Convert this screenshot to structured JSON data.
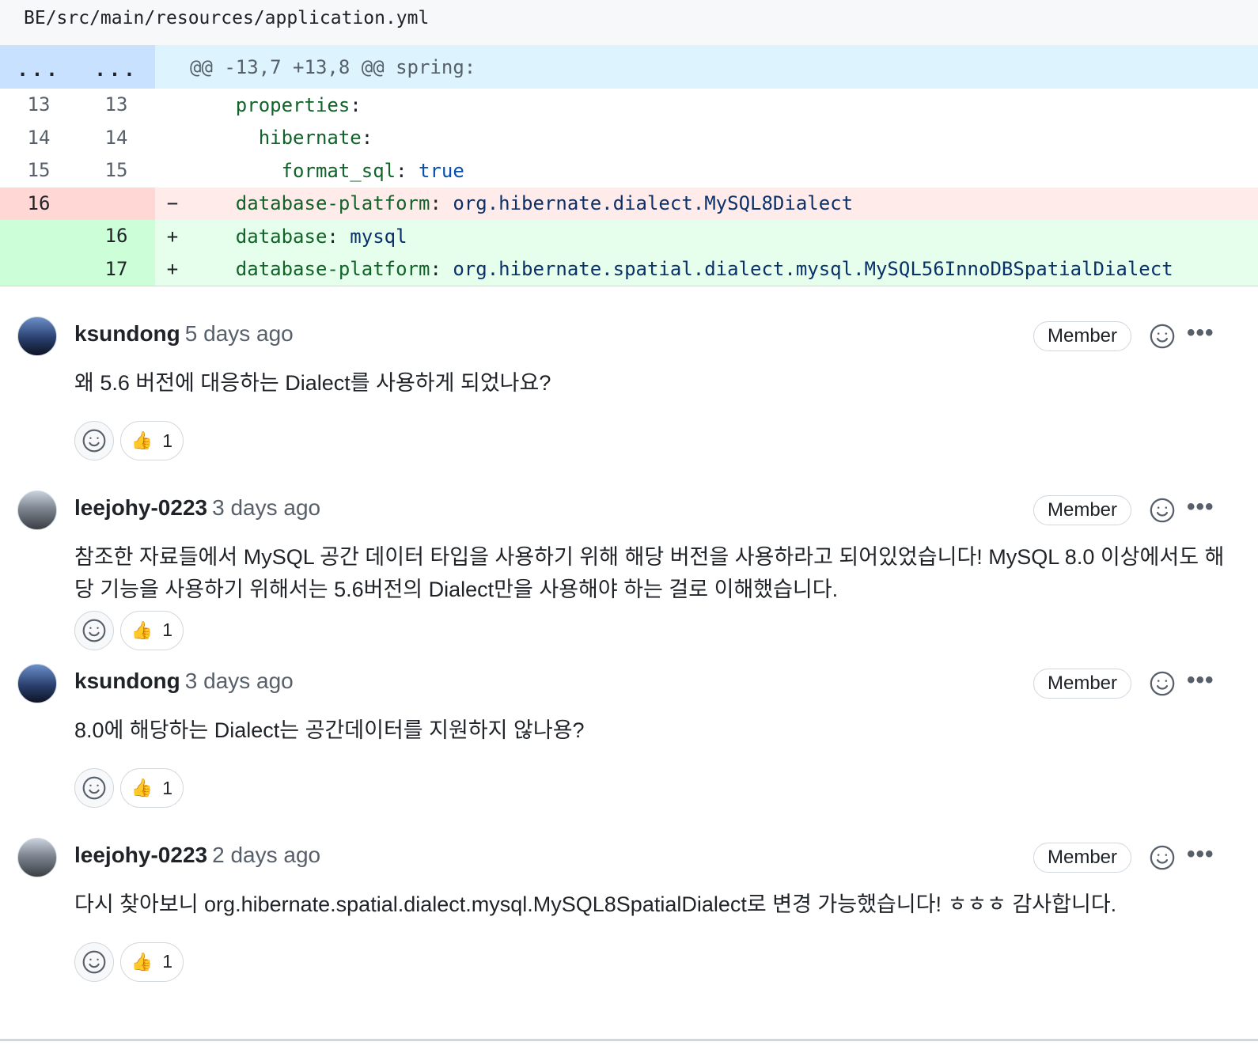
{
  "file": {
    "path": "BE/src/main/resources/application.yml"
  },
  "diff": {
    "hunk": {
      "left": "...",
      "right": "...",
      "text": "@@ -13,7 +13,8 @@ spring:"
    },
    "lines": [
      {
        "type": "context",
        "old": "13",
        "new": "13",
        "marker": "",
        "indent": "    ",
        "key": "properties",
        "sep": ":",
        "value": ""
      },
      {
        "type": "context",
        "old": "14",
        "new": "14",
        "marker": "",
        "indent": "      ",
        "key": "hibernate",
        "sep": ":",
        "value": ""
      },
      {
        "type": "context",
        "old": "15",
        "new": "15",
        "marker": "",
        "indent": "        ",
        "key": "format_sql",
        "sep": ": ",
        "value": "true",
        "value_kind": "bool"
      },
      {
        "type": "del",
        "old": "16",
        "new": "",
        "marker": "−",
        "indent": "    ",
        "key": "database-platform",
        "sep": ": ",
        "value": "org.hibernate.dialect.MySQL8Dialect"
      },
      {
        "type": "add",
        "old": "",
        "new": "16",
        "marker": "+",
        "indent": "    ",
        "key": "database",
        "sep": ": ",
        "value": "mysql"
      },
      {
        "type": "add",
        "old": "",
        "new": "17",
        "marker": "+",
        "indent": "    ",
        "key": "database-platform",
        "sep": ": ",
        "value": "org.hibernate.spatial.dialect.mysql.MySQL56InnoDBSpatialDialect"
      }
    ]
  },
  "comments": [
    {
      "author": "ksundong",
      "time": "5 days ago",
      "badge": "Member",
      "body": "왜 5.6 버전에 대응하는 Dialect를 사용하게 되었나요?",
      "reaction": {
        "emoji": "👍",
        "count": "1"
      }
    },
    {
      "author": "leejohy-0223",
      "time": "3 days ago",
      "badge": "Member",
      "body": "참조한 자료들에서 MySQL 공간 데이터 타입을 사용하기 위해 해당 버전을 사용하라고 되어있었습니다! MySQL 8.0 이상에서도 해당 기능을 사용하기 위해서는 5.6버전의 Dialect만을 사용해야 하는 걸로 이해했습니다.",
      "reaction": {
        "emoji": "👍",
        "count": "1"
      }
    },
    {
      "author": "ksundong",
      "time": "3 days ago",
      "badge": "Member",
      "body": "8.0에 해당하는 Dialect는 공간데이터를 지원하지 않나용?",
      "reaction": {
        "emoji": "👍",
        "count": "1"
      }
    },
    {
      "author": "leejohy-0223",
      "time": "2 days ago",
      "badge": "Member",
      "body": "다시 찾아보니 org.hibernate.spatial.dialect.mysql.MySQL8SpatialDialect로 변경 가능했습니다! ㅎㅎㅎ 감사합니다.",
      "reaction": {
        "emoji": "👍",
        "count": "1"
      }
    }
  ],
  "icons": {
    "smiley": "smiley-icon",
    "kebab": "kebab-horizontal-icon",
    "thumbsup": "thumbs-up-icon"
  },
  "colors": {
    "hunk_bg": "#ddf4ff",
    "del_bg": "#ffebe9",
    "add_bg": "#e6ffec",
    "key": "#116329",
    "value": "#0a3069"
  }
}
